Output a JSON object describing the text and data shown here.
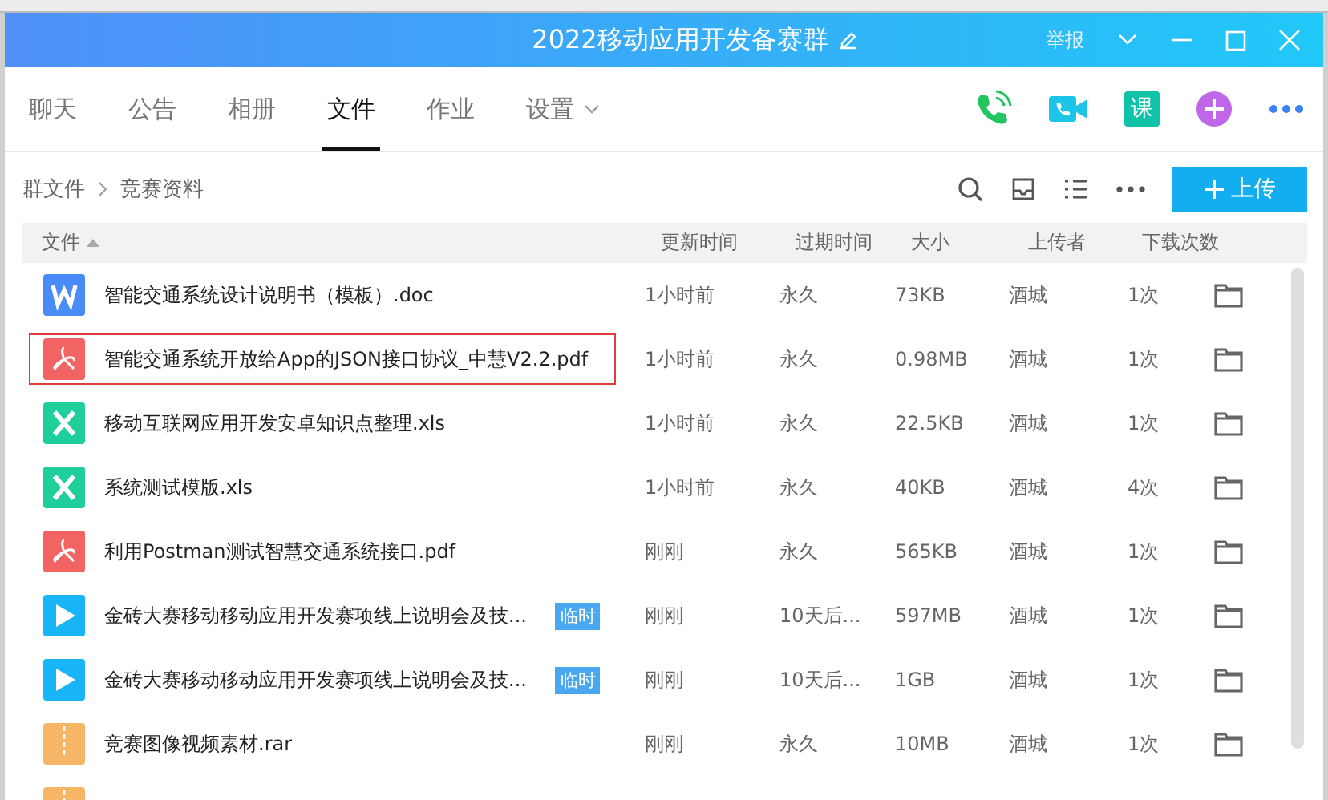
{
  "window": {
    "title": "2022移动应用开发备赛群",
    "report": "举报"
  },
  "tabs": [
    {
      "label": "聊天",
      "selected": false
    },
    {
      "label": "公告",
      "selected": false
    },
    {
      "label": "相册",
      "selected": false
    },
    {
      "label": "文件",
      "selected": true
    },
    {
      "label": "作业",
      "selected": false
    },
    {
      "label": "设置",
      "selected": false,
      "dropdown": true
    }
  ],
  "tab_actions": {
    "course_label": "课"
  },
  "breadcrumb": [
    "群文件",
    "竞赛资料"
  ],
  "upload_button": "上传",
  "table": {
    "columns": [
      "文件",
      "更新时间",
      "过期时间",
      "大小",
      "上传者",
      "下载次数"
    ],
    "rows": [
      {
        "kind": "doc",
        "name": "智能交通系统设计说明书（模板）.doc",
        "updated": "1小时前",
        "expires": "永久",
        "size": "73KB",
        "uploader": "酒城",
        "downloads": "1次",
        "selected": false
      },
      {
        "kind": "pdf",
        "name": "智能交通系统开放给App的JSON接口协议_中慧V2.2.pdf",
        "updated": "1小时前",
        "expires": "永久",
        "size": "0.98MB",
        "uploader": "酒城",
        "downloads": "1次",
        "selected": true
      },
      {
        "kind": "xls",
        "name": "移动互联网应用开发安卓知识点整理.xls",
        "updated": "1小时前",
        "expires": "永久",
        "size": "22.5KB",
        "uploader": "酒城",
        "downloads": "1次",
        "selected": false
      },
      {
        "kind": "xls",
        "name": "系统测试模版.xls",
        "updated": "1小时前",
        "expires": "永久",
        "size": "40KB",
        "uploader": "酒城",
        "downloads": "4次",
        "selected": false
      },
      {
        "kind": "pdf",
        "name": "利用Postman测试智慧交通系统接口.pdf",
        "updated": "刚刚",
        "expires": "永久",
        "size": "565KB",
        "uploader": "酒城",
        "downloads": "1次",
        "selected": false
      },
      {
        "kind": "video",
        "name": "金砖大赛移动移动应用开发赛项线上说明会及技...",
        "tag": "临时",
        "updated": "刚刚",
        "expires": "10天后...",
        "size": "597MB",
        "uploader": "酒城",
        "downloads": "1次",
        "selected": false
      },
      {
        "kind": "video",
        "name": "金砖大赛移动移动应用开发赛项线上说明会及技...",
        "tag": "临时",
        "updated": "刚刚",
        "expires": "10天后...",
        "size": "1GB",
        "uploader": "酒城",
        "downloads": "1次",
        "selected": false
      },
      {
        "kind": "rar",
        "name": "竞赛图像视频素材.rar",
        "updated": "刚刚",
        "expires": "永久",
        "size": "10MB",
        "uploader": "酒城",
        "downloads": "1次",
        "selected": false
      },
      {
        "kind": "rar"
      }
    ]
  }
}
